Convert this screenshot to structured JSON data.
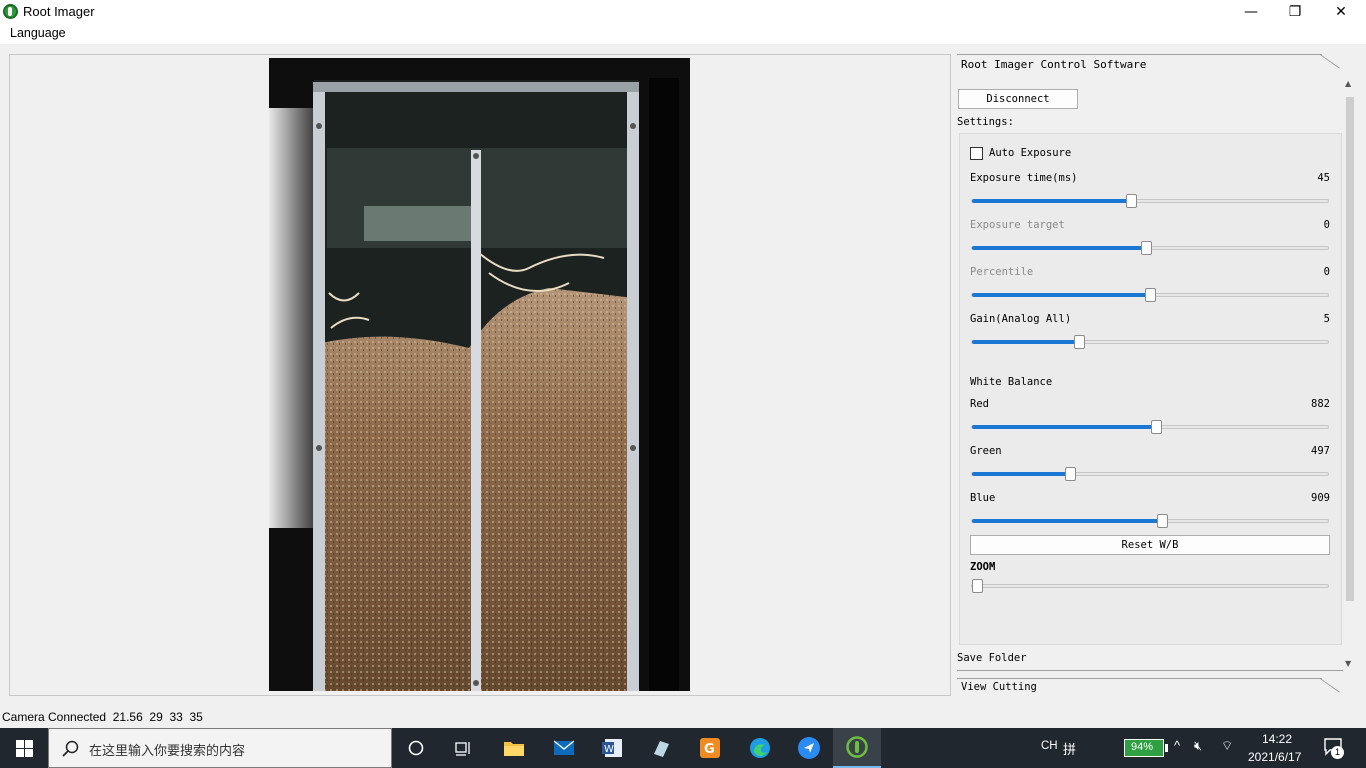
{
  "window": {
    "title": "Root Imager",
    "minimize": "—",
    "restore": "❐",
    "close": "✕"
  },
  "menu": {
    "language": "Language"
  },
  "panel": {
    "header_tab": "Root Imager Control Software",
    "disconnect_label": "Disconnect",
    "settings_label": "Settings:",
    "auto_exposure_label": "Auto Exposure",
    "sliders": [
      {
        "label": "Exposure time(ms)",
        "value": "45",
        "fraction": 0.445,
        "enabled": true
      },
      {
        "label": "Exposure target",
        "value": "0",
        "fraction": 0.49,
        "enabled": false
      },
      {
        "label": "Percentile",
        "value": "0",
        "fraction": 0.5,
        "enabled": false
      },
      {
        "label": "Gain(Analog All)",
        "value": "5",
        "fraction": 0.295,
        "enabled": true
      }
    ],
    "white_balance_label": "White Balance",
    "wb_sliders": [
      {
        "label": "Red",
        "value": "882",
        "fraction": 0.52
      },
      {
        "label": "Green",
        "value": "497",
        "fraction": 0.27
      },
      {
        "label": "Blue",
        "value": "909",
        "fraction": 0.535
      }
    ],
    "reset_wb_label": "Reset W/B",
    "zoom_label": "ZOOM",
    "zoom_fraction": 0.0,
    "save_folder_tab": "Save Folder",
    "view_cutting_tab": "View Cutting"
  },
  "status": {
    "text": "Camera Connected  21.56  29  33  35"
  },
  "taskbar": {
    "search_placeholder": "在这里输入你要搜索的内容",
    "ime_lang": "CH",
    "ime_mode": "拼",
    "battery": "94%",
    "time": "14:22",
    "date": "2021/6/17",
    "notification_count": "1"
  },
  "colors": {
    "accent": "#1a78d4",
    "taskbar": "#20272e",
    "battery_green": "#2ea043"
  }
}
